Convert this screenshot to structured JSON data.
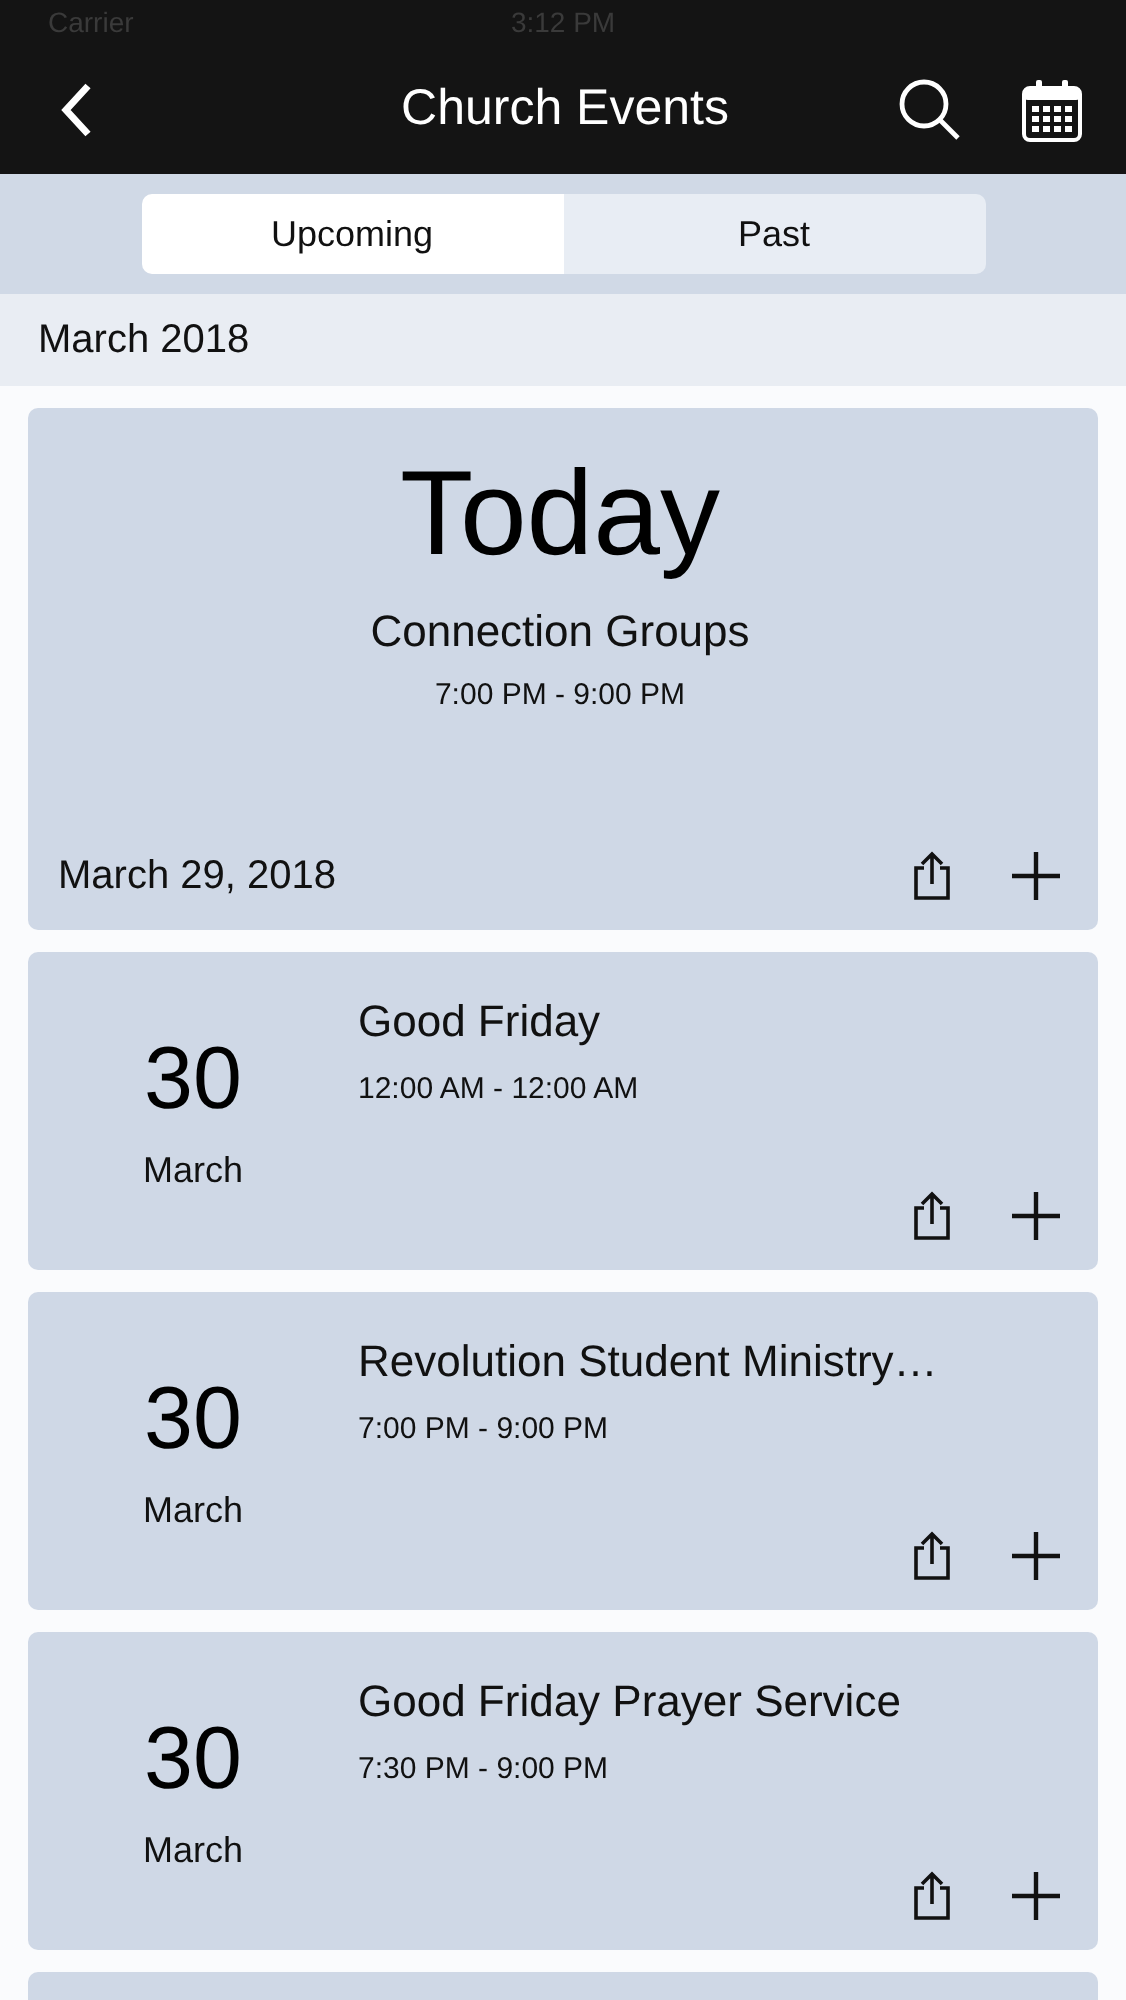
{
  "status_bar": {
    "carrier": "Carrier",
    "time": "3:12 PM"
  },
  "nav": {
    "title": "Church Events"
  },
  "tabs": [
    {
      "label": "Upcoming",
      "selected": true
    },
    {
      "label": "Past",
      "selected": false
    }
  ],
  "section": "March 2018",
  "featured": {
    "heading": "Today",
    "title": "Connection Groups",
    "time": "7:00 PM - 9:00 PM",
    "date": "March 29, 2018"
  },
  "events": [
    {
      "day": "30",
      "month": "March",
      "title": "Good Friday",
      "time": "12:00 AM - 12:00 AM"
    },
    {
      "day": "30",
      "month": "March",
      "title": "Revolution Student Ministry…",
      "time": "7:00 PM - 9:00 PM"
    },
    {
      "day": "30",
      "month": "March",
      "title": "Good Friday Prayer Service",
      "time": "7:30 PM - 9:00 PM"
    }
  ]
}
